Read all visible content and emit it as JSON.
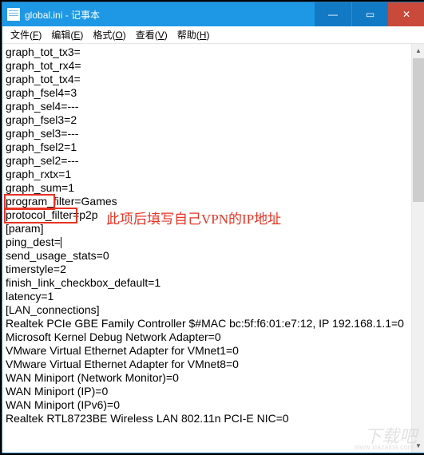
{
  "window": {
    "title": "global.ini - 记事本"
  },
  "menu": {
    "file": {
      "label": "文件",
      "key": "F"
    },
    "edit": {
      "label": "编辑",
      "key": "E"
    },
    "format": {
      "label": "格式",
      "key": "O"
    },
    "view": {
      "label": "查看",
      "key": "V"
    },
    "help": {
      "label": "帮助",
      "key": "H"
    }
  },
  "content": {
    "lines": [
      "graph_tot_tx3=",
      "graph_tot_rx4=",
      "graph_tot_tx4=",
      "graph_fsel4=3",
      "graph_sel4=---",
      "graph_fsel3=2",
      "graph_sel3=---",
      "graph_fsel2=1",
      "graph_sel2=---",
      "graph_rxtx=1",
      "graph_sum=1",
      "program_filter=Games",
      "protocol_filter=p2p",
      "[param]",
      "ping_dest=",
      "send_usage_stats=0",
      "timerstyle=2",
      "finish_link_checkbox_default=1",
      "latency=1",
      "[LAN_connections]",
      "Realtek PCIe GBE Family Controller $#MAC bc:5f:f6:01:e7:12, IP 192.168.1.1=0",
      "Microsoft Kernel Debug Network Adapter=0",
      "VMware Virtual Ethernet Adapter for VMnet1=0",
      "VMware Virtual Ethernet Adapter for VMnet8=0",
      "WAN Miniport (Network Monitor)=0",
      "WAN Miniport (IP)=0",
      "WAN Miniport (IPv6)=0",
      "Realtek RTL8723BE Wireless LAN 802.11n PCI-E NIC=0"
    ],
    "caret_line_index": 14
  },
  "annotation": {
    "text": "此项后填写自己VPN的IP地址"
  },
  "watermark": {
    "main": "下载吧",
    "sub": "www.xiazaiba.com"
  },
  "controls": {
    "min_glyph": "—",
    "max_glyph": "▭",
    "close_glyph": "✕",
    "arrow_up": "▲",
    "arrow_down": "▼"
  }
}
